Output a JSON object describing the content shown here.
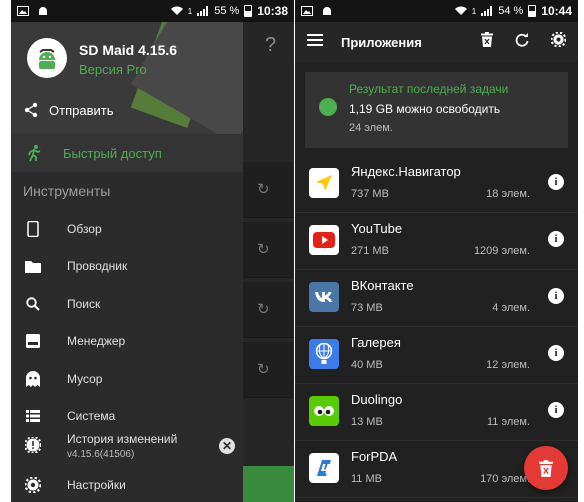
{
  "left_status": {
    "battery": "55 %",
    "time": "10:38",
    "sim": "1"
  },
  "right_status": {
    "battery": "54 %",
    "time": "10:44",
    "sim": "1"
  },
  "drawer": {
    "app_name": "SD Maid 4.15.6",
    "version_label": "Версия Pro",
    "share_label": "Отправить",
    "quick_access_label": "Быстрый доступ",
    "tools_heading": "Инструменты",
    "items": [
      {
        "label": "Обзор",
        "icon": "phone-icon"
      },
      {
        "label": "Проводник",
        "icon": "folder-icon"
      },
      {
        "label": "Поиск",
        "icon": "search-icon"
      },
      {
        "label": "Менеджер",
        "icon": "app-manager-icon"
      },
      {
        "label": "Мусор",
        "icon": "ghost-icon"
      },
      {
        "label": "Система",
        "icon": "list-icon"
      }
    ],
    "changelog_title": "История изменений",
    "changelog_version": "v4.15.6(41506)",
    "settings_label": "Настройки"
  },
  "background_app": {
    "help_glyph": "?"
  },
  "toolbar": {
    "title": "Приложения"
  },
  "last_task": {
    "heading": "Результат последней задачи",
    "freeable": "1,19 GB можно освободить",
    "count": "24 элем."
  },
  "apps": [
    {
      "name": "Яндекс.Навигатор",
      "size": "737 MB",
      "count": "18 элем.",
      "icon": "yandex-navigator-icon",
      "icon_bg": "#ffffff"
    },
    {
      "name": "YouTube",
      "size": "271 MB",
      "count": "1209 элем.",
      "icon": "youtube-icon",
      "icon_bg": "#ffffff"
    },
    {
      "name": "ВКонтакте",
      "size": "73 MB",
      "count": "4 элем.",
      "icon": "vk-icon",
      "icon_bg": "#4a76a8"
    },
    {
      "name": "Галерея",
      "size": "40 MB",
      "count": "12 элем.",
      "icon": "gallery-icon",
      "icon_bg": "#3b7bea"
    },
    {
      "name": "Duolingo",
      "size": "13 MB",
      "count": "11 элем.",
      "icon": "duolingo-icon",
      "icon_bg": "#58cc02"
    },
    {
      "name": "ForPDA",
      "size": "11 MB",
      "count": "170 элем.",
      "icon": "forpda-icon",
      "icon_bg": "#ffffff"
    }
  ],
  "colors": {
    "accent_green": "#4caf50",
    "fab_red": "#e53935"
  }
}
